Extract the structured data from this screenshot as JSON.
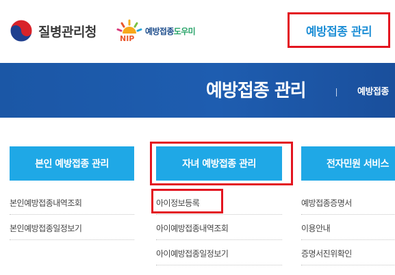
{
  "header": {
    "agency_name": "질병관리청",
    "nip_logo_text_main": "예방접종",
    "nip_logo_text_accent": "도우미",
    "nip_logo_letters": "NIP",
    "top_menu_label": "예방접종 관리"
  },
  "banner": {
    "title": "예방접종 관리",
    "breadcrumb": "예방접종"
  },
  "columns": [
    {
      "title": "본인 예방접종 관리",
      "items": [
        "본인예방접종내역조회",
        "본인예방접종일정보기"
      ]
    },
    {
      "title": "자녀 예방접종 관리",
      "items": [
        "아이정보등록",
        "아이예방접종내역조회",
        "아이예방접종일정보기"
      ]
    },
    {
      "title": "전자민원 서비스",
      "items": [
        "예방접종증명서",
        "이용안내",
        "증명서진위확인"
      ]
    }
  ],
  "colors": {
    "brand_blue": "#1b57a6",
    "button_blue": "#1fa8e6",
    "menu_text": "#1f8fd6",
    "highlight_red": "#e3141f"
  }
}
